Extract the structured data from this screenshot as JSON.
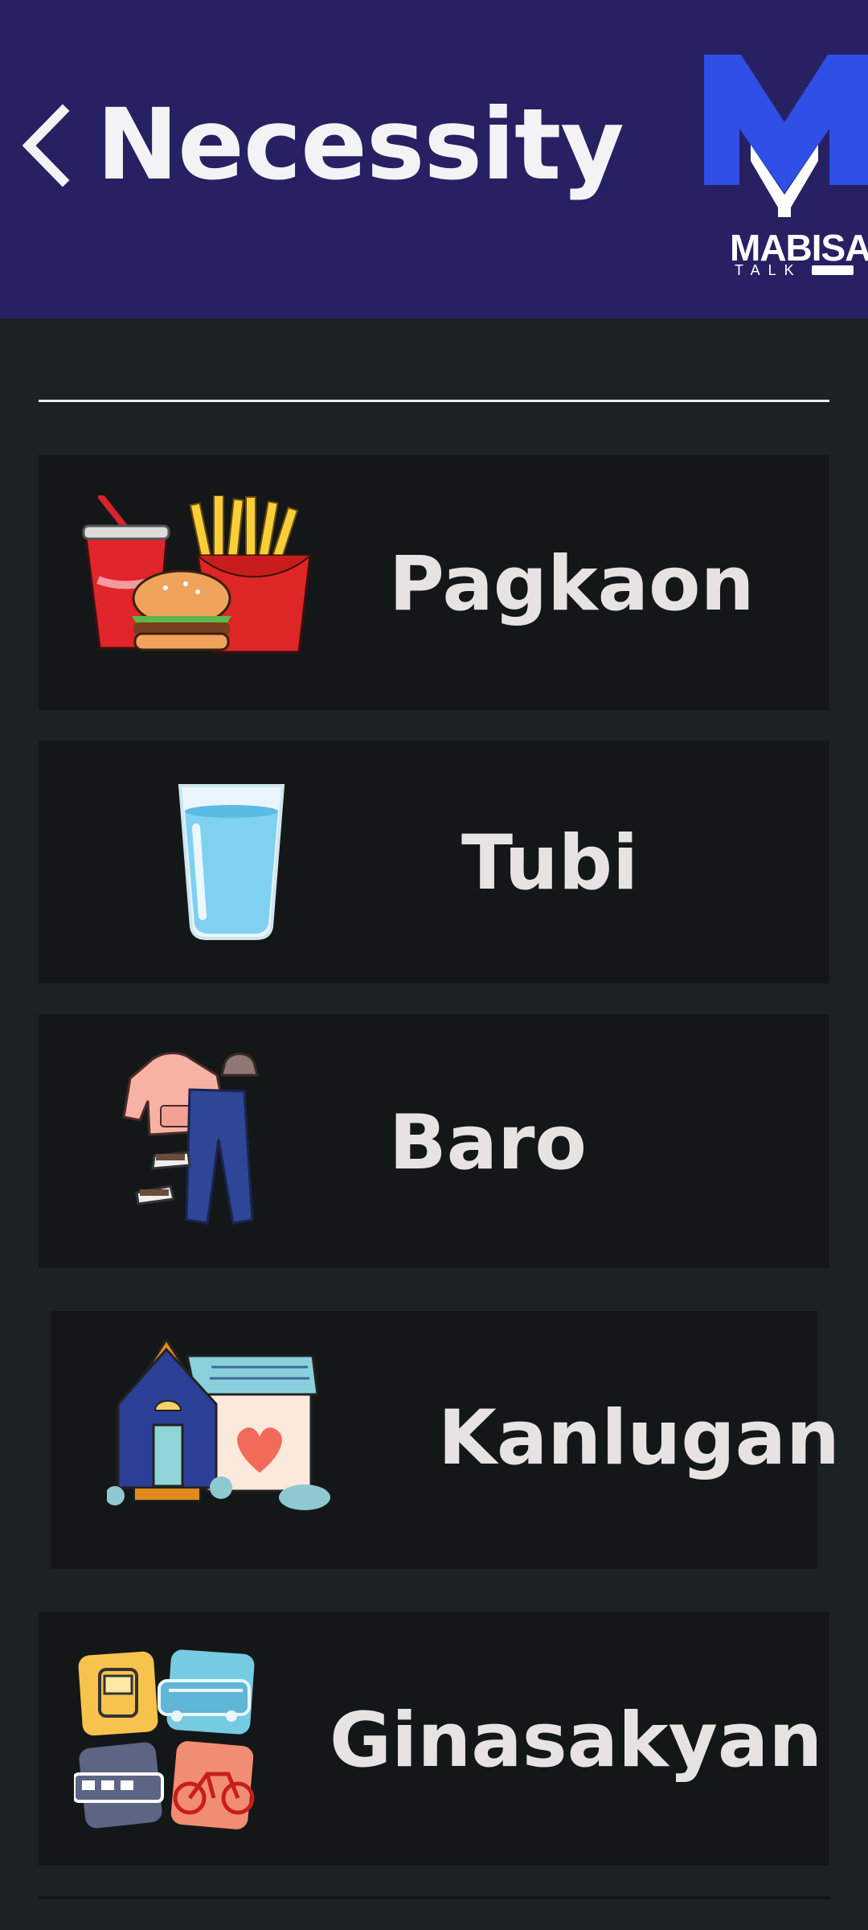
{
  "header": {
    "title": "Necessity",
    "background_color": "#272163",
    "logo": {
      "brand_text": "MABISA",
      "sub_text": "TALK",
      "mark_color": "#2f4fe6"
    }
  },
  "categories": [
    {
      "label": "Pagkaon",
      "icon": "fast-food-icon"
    },
    {
      "label": "Tubi",
      "icon": "water-glass-icon"
    },
    {
      "label": "Baro",
      "icon": "clothes-icon"
    },
    {
      "label": "Kanlugan",
      "icon": "house-icon"
    },
    {
      "label": "Ginasakyan",
      "icon": "transport-icon"
    }
  ],
  "colors": {
    "page_background": "#1c2124",
    "card_background": "#141718",
    "label_text": "#e7e3e3",
    "header_text": "#f3f3f5"
  }
}
